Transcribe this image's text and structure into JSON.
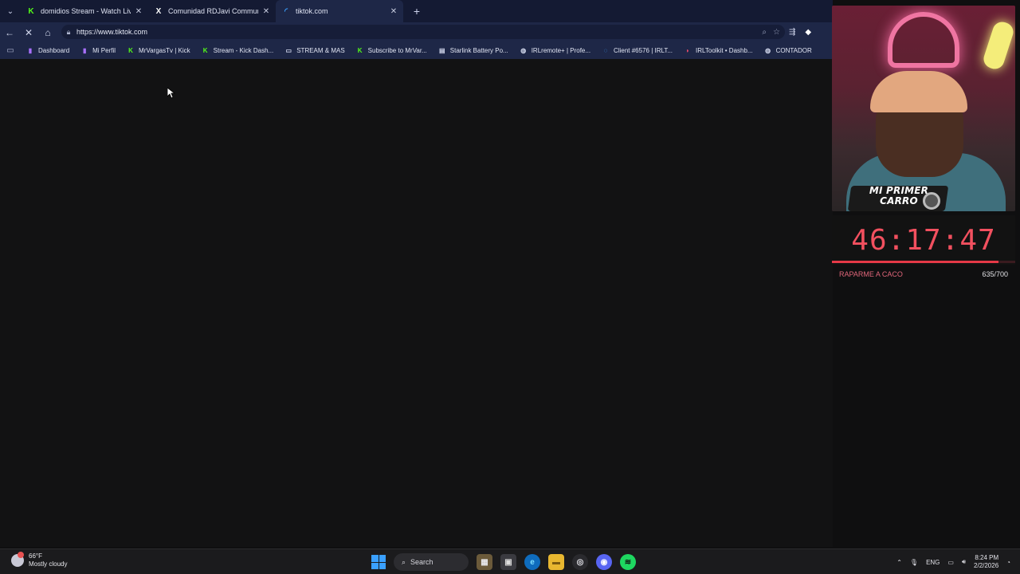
{
  "browser": {
    "tabs": [
      {
        "title": "domidios Stream - Watch Live on",
        "favicon": "kick-icon",
        "color": "#53fc18"
      },
      {
        "title": "Comunidad RDJavi Community",
        "favicon": "x-icon",
        "color": "#ffffff"
      },
      {
        "title": "tiktok.com",
        "favicon": "loading-spinner-icon",
        "color": "#3aa0ff",
        "active": true
      }
    ],
    "url": "https://www.tiktok.com",
    "bookmarks": [
      {
        "label": "Dashboard",
        "icon": "twitch-icon",
        "color": "#a970ff"
      },
      {
        "label": "Mi Perfil",
        "icon": "twitch-icon",
        "color": "#a970ff"
      },
      {
        "label": "MrVargasTv | Kick",
        "icon": "kick-icon",
        "color": "#53fc18"
      },
      {
        "label": "Stream - Kick Dash...",
        "icon": "kick-icon",
        "color": "#53fc18"
      },
      {
        "label": "STREAM & MAS",
        "icon": "folder-icon",
        "color": "#cfd5ea"
      },
      {
        "label": "Subscribe to MrVar...",
        "icon": "kick-icon",
        "color": "#53fc18"
      },
      {
        "label": "Starlink Battery Po...",
        "icon": "page-icon",
        "color": "#cfd5ea"
      },
      {
        "label": "IRLremote+ | Profe...",
        "icon": "globe-icon",
        "color": "#cfd5ea"
      },
      {
        "label": "Client #6576 | IRLT...",
        "icon": "spinner-icon",
        "color": "#3aa0ff"
      },
      {
        "label": "IRLToolkit • Dashb...",
        "icon": "irltoolkit-icon",
        "color": "#ff4d6d"
      },
      {
        "label": "CONTADOR",
        "icon": "globe-icon",
        "color": "#cfd5ea"
      }
    ]
  },
  "overlay": {
    "badge_line1": "MI PRIMER",
    "badge_line2": "CARRO",
    "timer": "46:17:47",
    "goal_label": "RAPARME A CACO",
    "goal_count": "635/700",
    "goal_progress": 0.907,
    "accent": "#f2505f"
  },
  "taskbar": {
    "weather_temp": "66°F",
    "weather_desc": "Mostly cloudy",
    "search_label": "Search",
    "language": "ENG",
    "time": "8:24 PM",
    "date": "2/2/2026"
  }
}
